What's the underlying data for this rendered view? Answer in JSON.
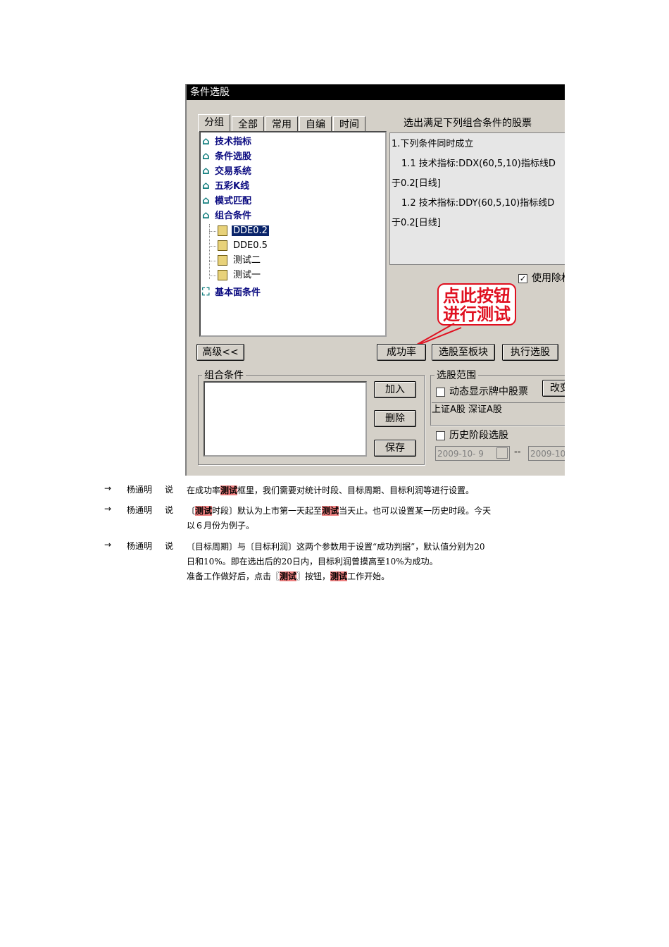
{
  "dialog": {
    "title": "条件选股",
    "tabs": [
      "分组",
      "全部",
      "常用",
      "自编",
      "时间"
    ],
    "tree": {
      "categories": [
        "技术指标",
        "条件选股",
        "交易系统",
        "五彩K线",
        "模式匹配",
        "组合条件"
      ],
      "combo_items": [
        "DDE0.2",
        "DDE0.5",
        "测试二",
        "测试一"
      ],
      "selected_item": "DDE0.2",
      "fundamentals": "基本面条件"
    },
    "condition_header": "选出满足下列组合条件的股票",
    "conditions": [
      "1.下列条件同时成立",
      "1.1 技术指标:DDX(60,5,10)指标线D",
      "于0.2[日线]",
      "1.2 技术指标:DDY(60,5,10)指标线D",
      "于0.2[日线]"
    ],
    "use_exrights": {
      "label": "使用除权",
      "checked": true
    },
    "callout": [
      "点此按钮",
      "进行测试"
    ],
    "buttons": {
      "advanced": "高级<<",
      "success_rate": "成功率",
      "to_block": "选股至板块",
      "run": "执行选股",
      "add": "加入",
      "delete": "删除",
      "save": "保存",
      "modify": "改变"
    },
    "combo_group_label": "组合条件",
    "range": {
      "label": "选股范围",
      "dynamic": "动态显示牌中股票",
      "markets": "上证A股 深证A股",
      "history": "历史阶段选股",
      "date_from": "2009-10- 9",
      "date_sep": "--",
      "date_to": "2009-10"
    }
  },
  "notes": [
    {
      "arrow": "→",
      "speaker": "杨通明",
      "said": "说",
      "lines": [
        [
          "在成功率",
          "测试",
          "框里，我们需要对统计时段、目标周期、目标利润等进行设置。"
        ]
      ]
    },
    {
      "arrow": "→",
      "speaker": "杨通明",
      "said": "说",
      "lines": [
        [
          "〔",
          "测试",
          "时段〕默认为上市第一天起至",
          "测试",
          "当天止。也可以设置某一历史时段。今天"
        ],
        [
          "以６月份为例子。"
        ]
      ]
    },
    {
      "arrow": "→",
      "speaker": "杨通明",
      "said": "说",
      "lines": [
        [
          "〔目标周期〕与〔目标利润〕这两个参数用于设置“成功判据”，默认值分别为20"
        ],
        [
          "日和10%。即在选出后的20日内，目标利润曾摸高至10%为成功。"
        ],
        [
          "准备工作做好后，点击〖",
          "测试",
          "〗按钮，",
          "测试",
          "工作开始。"
        ]
      ]
    }
  ]
}
